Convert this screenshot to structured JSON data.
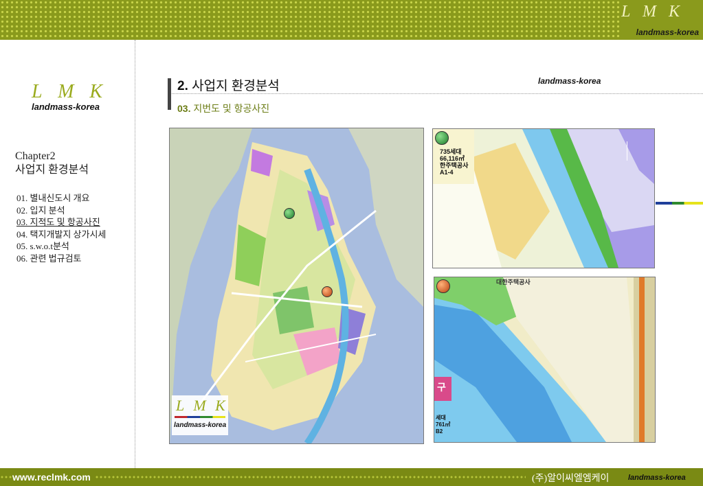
{
  "header": {
    "brand": "L M K",
    "brand_sub": "landmass-korea"
  },
  "sidebar": {
    "brand": "L M K",
    "brand_sub": "landmass-korea",
    "chapter_line1": "Chapter2",
    "chapter_line2": "사업지 환경분석",
    "items": [
      {
        "label": "01. 별내신도시 개요",
        "active": false
      },
      {
        "label": "02. 입지 분석",
        "active": false
      },
      {
        "label": "03. 지적도 및 항공사진",
        "active": true
      },
      {
        "label": "04. 택지개발지 상가시세",
        "active": false
      },
      {
        "label": "05. s.w.o.t분석",
        "active": false
      },
      {
        "label": "06. 관련 법규검토",
        "active": false
      }
    ]
  },
  "main": {
    "title_number": "2.",
    "title_text": "사업지 환경분석",
    "subtitle_number": "03.",
    "subtitle_text": "지번도 및 항공사진",
    "top_right_label": "landmass-korea",
    "map_logo": "L M K",
    "map_logo_sub": "landmass-korea",
    "map_labels": {
      "tr_units": "735세대",
      "tr_area": "66,116㎡",
      "tr_corp": "한주택공사",
      "tr_block": "A1-4",
      "br_corp": "대한주택공사",
      "br_gu": "구",
      "br_units": "세대",
      "br_area": "761㎡",
      "br_block": "B2"
    }
  },
  "footer": {
    "url": "www.reclmk.com",
    "company": "(주)알이씨엘엠케이",
    "company_sub": "landmass-korea"
  },
  "colors": {
    "olive": "#8a9a1c",
    "brand_green": "#9aab1e",
    "marker_green": "#1c7a2a",
    "marker_orange": "#b8400e"
  }
}
